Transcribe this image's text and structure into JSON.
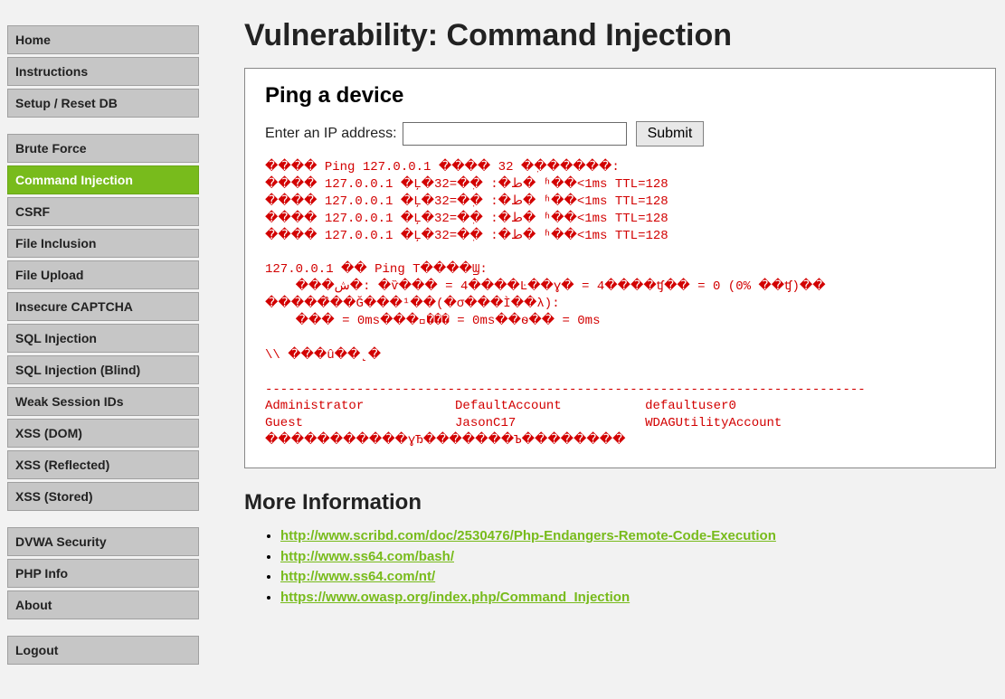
{
  "heading": "Vulnerability: Command Injection",
  "nav": {
    "group1": [
      {
        "label": "Home",
        "name": "nav-home"
      },
      {
        "label": "Instructions",
        "name": "nav-instructions"
      },
      {
        "label": "Setup / Reset DB",
        "name": "nav-setup"
      }
    ],
    "group2": [
      {
        "label": "Brute Force",
        "name": "nav-brute-force"
      },
      {
        "label": "Command Injection",
        "name": "nav-command-injection",
        "active": true
      },
      {
        "label": "CSRF",
        "name": "nav-csrf"
      },
      {
        "label": "File Inclusion",
        "name": "nav-file-inclusion"
      },
      {
        "label": "File Upload",
        "name": "nav-file-upload"
      },
      {
        "label": "Insecure CAPTCHA",
        "name": "nav-insecure-captcha"
      },
      {
        "label": "SQL Injection",
        "name": "nav-sql-injection"
      },
      {
        "label": "SQL Injection (Blind)",
        "name": "nav-sql-injection-blind"
      },
      {
        "label": "Weak Session IDs",
        "name": "nav-weak-session-ids"
      },
      {
        "label": "XSS (DOM)",
        "name": "nav-xss-dom"
      },
      {
        "label": "XSS (Reflected)",
        "name": "nav-xss-reflected"
      },
      {
        "label": "XSS (Stored)",
        "name": "nav-xss-stored"
      }
    ],
    "group3": [
      {
        "label": "DVWA Security",
        "name": "nav-dvwa-security"
      },
      {
        "label": "PHP Info",
        "name": "nav-php-info"
      },
      {
        "label": "About",
        "name": "nav-about"
      }
    ],
    "group4": [
      {
        "label": "Logout",
        "name": "nav-logout"
      }
    ]
  },
  "panel": {
    "title": "Ping a device",
    "label": "Enter an IP address:",
    "submit": "Submit",
    "output_lines": [
      "���� Ping 127.0.0.1 ���� 32 �ֽ������:",
      "���� 127.0.0.1 �Ļ�32=�ֽ� :�ط� ʱ��<1ms TTL=128",
      "���� 127.0.0.1 �Ļ�32=�ֽ� :�ط� ʱ��<1ms TTL=128",
      "���� 127.0.0.1 �Ļ�32=�ֽ� :�ط� ʱ��<1ms TTL=128",
      "���� 127.0.0.1 �Ļ�32=�ֽ� :�ط� ʱ��<1ms TTL=128",
      "",
      "127.0.0.1 �� Ping T����Ϣ:",
      "    ���ش�: �ѷ��� = 4����Ŀ��ɣ� = 4����ʧ�� = 0 (0% ��ʧ)��",
      "�����̂��Ğ���¹��(�σ���Ì��λ):",
      "    ��� = 0ms���󱿐��� = 0ms��ѳ�� = 0ms",
      "",
      "\\\\ ���û��˻�",
      "",
      "-------------------------------------------------------------------------------",
      "Administrator            DefaultAccount           defaultuser0",
      "Guest                    JasonC17                 WDAGUtilityAccount",
      "�����������ɣЂ�������Ъ��������"
    ]
  },
  "more_info": {
    "title": "More Information",
    "links": [
      "http://www.scribd.com/doc/2530476/Php-Endangers-Remote-Code-Execution",
      "http://www.ss64.com/bash/",
      "http://www.ss64.com/nt/",
      "https://www.owasp.org/index.php/Command_Injection"
    ]
  }
}
